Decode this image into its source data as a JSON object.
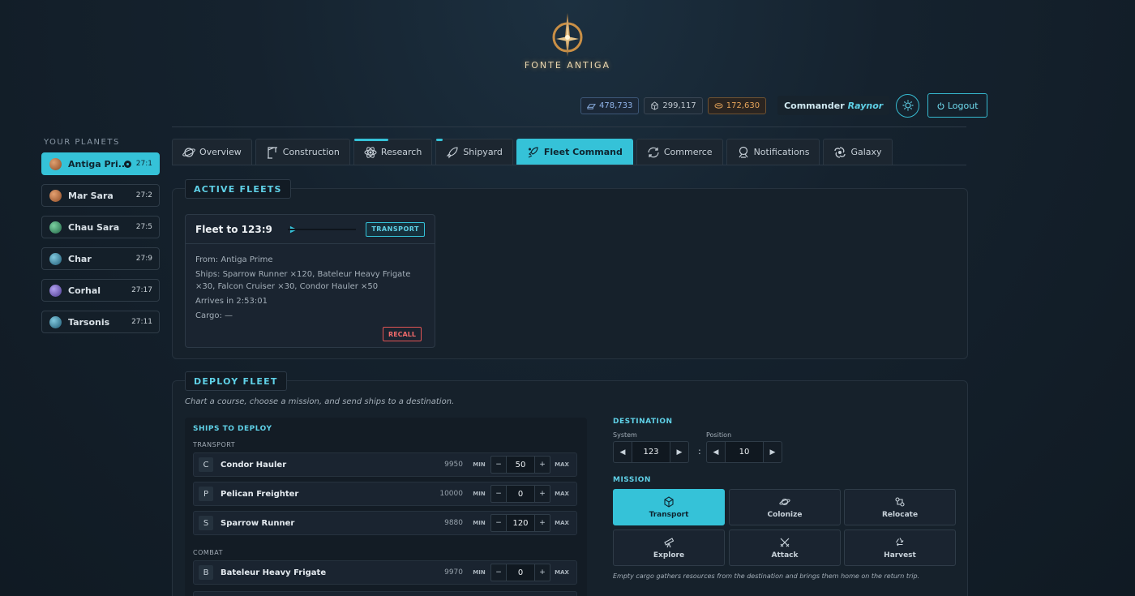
{
  "brand": {
    "name": "FONTE ANTIGA",
    "logo_icon": "star-emblem-icon"
  },
  "topbar": {
    "resources": [
      {
        "icon": "metal-icon",
        "value": "478,733",
        "color": "#8fb3e8"
      },
      {
        "icon": "crystal-icon",
        "value": "299,117",
        "color": "#c0c8d0"
      },
      {
        "icon": "fuel-icon",
        "value": "172,630",
        "color": "#e6a45a"
      }
    ],
    "commander_prefix": "Commander",
    "commander_name": "Raynor",
    "theme_icon": "sun-icon",
    "logout_label": "Logout"
  },
  "sidebar": {
    "title": "YOUR PLANETS",
    "planets": [
      {
        "name": "Antiga Pri...",
        "coord": "27:1",
        "color": "#b86a3a"
      },
      {
        "name": "Mar Sara",
        "coord": "27:2",
        "color": "#c07a48"
      },
      {
        "name": "Chau Sara",
        "coord": "27:5",
        "color": "#3f9a68"
      },
      {
        "name": "Char",
        "coord": "27:9",
        "color": "#3a8aa6"
      },
      {
        "name": "Corhal",
        "coord": "27:17",
        "color": "#7a62c4"
      },
      {
        "name": "Tarsonis",
        "coord": "27:11",
        "color": "#3a8aa6"
      }
    ]
  },
  "tabs": [
    {
      "label": "Overview",
      "icon": "planet-icon"
    },
    {
      "label": "Construction",
      "icon": "crane-icon"
    },
    {
      "label": "Research",
      "icon": "atom-icon"
    },
    {
      "label": "Shipyard",
      "icon": "rocket-icon"
    },
    {
      "label": "Fleet Command",
      "icon": "fleet-icon"
    },
    {
      "label": "Commerce",
      "icon": "exchange-icon"
    },
    {
      "label": "Notifications",
      "icon": "bell-icon"
    },
    {
      "label": "Galaxy",
      "icon": "galaxy-icon"
    }
  ],
  "active_fleets": {
    "title": "ACTIVE FLEETS",
    "fleet": {
      "title": "Fleet to 123:9",
      "mission": "TRANSPORT",
      "from": "From: Antiga Prime",
      "ships": "Ships: Sparrow Runner ×120, Bateleur Heavy Frigate ×30, Falcon Cruiser ×30, Condor Hauler ×50",
      "arrives": "Arrives in 2:53:01",
      "cargo": "Cargo: —",
      "recall_label": "RECALL"
    }
  },
  "deploy": {
    "title": "DEPLOY FLEET",
    "subtitle": "Chart a course, choose a mission, and send ships to a destination.",
    "ships_title": "SHIPS TO DEPLOY",
    "categories": {
      "transport": "TRANSPORT",
      "combat": "COMBAT"
    },
    "min_label": "MIN",
    "max_label": "MAX",
    "transport_ships": [
      {
        "letter": "C",
        "name": "Condor Hauler",
        "available": "9950",
        "value": "50"
      },
      {
        "letter": "P",
        "name": "Pelican Freighter",
        "available": "10000",
        "value": "0"
      },
      {
        "letter": "S",
        "name": "Sparrow Runner",
        "available": "9880",
        "value": "120"
      }
    ],
    "combat_ships": [
      {
        "letter": "B",
        "name": "Bateleur Heavy Frigate",
        "available": "9970",
        "value": "0"
      }
    ],
    "destination": {
      "title": "DESTINATION",
      "system_label": "System",
      "system_value": "123",
      "position_label": "Position",
      "position_value": "10"
    },
    "mission": {
      "title": "MISSION",
      "options": [
        {
          "label": "Transport",
          "icon": "cube-icon",
          "active": true
        },
        {
          "label": "Colonize",
          "icon": "planet-ring-icon",
          "active": false
        },
        {
          "label": "Relocate",
          "icon": "relocate-icon",
          "active": false
        },
        {
          "label": "Explore",
          "icon": "telescope-icon",
          "active": false
        },
        {
          "label": "Attack",
          "icon": "crossed-swords-icon",
          "active": false
        },
        {
          "label": "Harvest",
          "icon": "recycle-icon",
          "active": false
        }
      ],
      "note": "Empty cargo gathers resources from the destination and brings them home on the return trip."
    }
  }
}
